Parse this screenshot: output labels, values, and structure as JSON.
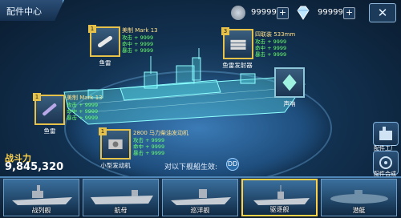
{
  "header": {
    "title": "配件中心"
  },
  "resources": [
    {
      "icon": "silver-coin-icon",
      "value": "99999",
      "plus": "+"
    },
    {
      "icon": "diamond-icon",
      "value": "99999",
      "plus": "+"
    }
  ],
  "close": "✕",
  "slots": {
    "torpedo": {
      "caption": "鱼雷",
      "name": "美制 Mark 13",
      "level": "1",
      "stats": [
        "攻击 + 9999",
        "命中 + 9999",
        "暴击 + 9999"
      ]
    },
    "torpedo_launcher": {
      "caption": "鱼雷发射器",
      "name": "四联装 533mm",
      "level": "3",
      "stats": [
        "攻击 + 9999",
        "命中 + 9999",
        "暴击 + 9999"
      ]
    },
    "torpedo2": {
      "caption": "鱼雷",
      "name": "美制 Mark 13",
      "level": "1",
      "stats": [
        "攻击 + 9999",
        "命中 + 9999",
        "暴击 + 9999"
      ]
    },
    "scope": {
      "caption": "声呐"
    },
    "engine": {
      "caption": "小型发动机",
      "name": "2800 马力柴油发动机",
      "level": "1",
      "stats": [
        "攻击 + 9999",
        "命中 + 9999",
        "暴击 + 9999"
      ]
    }
  },
  "battle": {
    "label": "战斗力",
    "value": "9,845,320"
  },
  "hint": {
    "text": "对以下舰船生效:",
    "mark": "DD"
  },
  "side_buttons": [
    {
      "label": "配件工厂"
    },
    {
      "label": "配件合成"
    }
  ],
  "tabs": [
    {
      "label": "战列舰"
    },
    {
      "label": "航母"
    },
    {
      "label": "巡洋舰"
    },
    {
      "label": "驱逐舰"
    },
    {
      "label": "潜艇"
    }
  ],
  "colors": {
    "gold": "#e6c24a",
    "stat_green": "#6cff6c",
    "name_yellow": "#ffe08a"
  }
}
